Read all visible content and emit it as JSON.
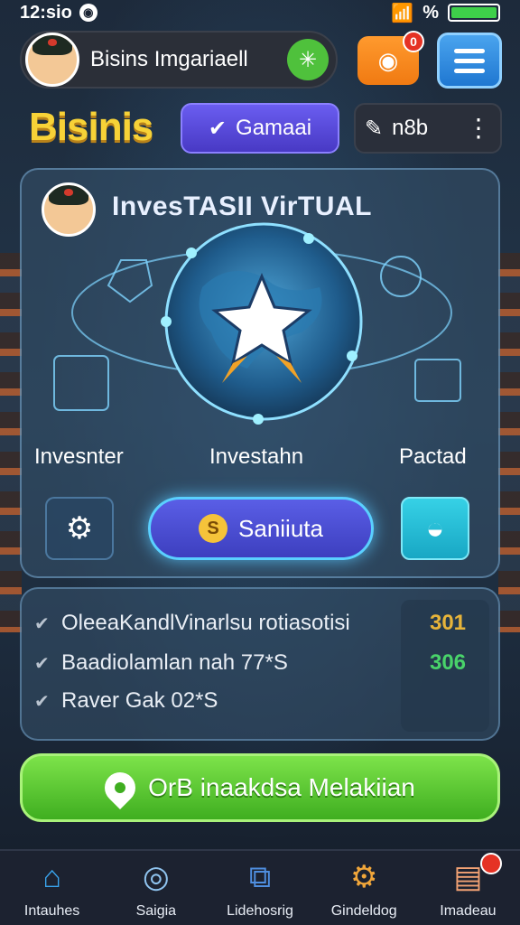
{
  "status_bar": {
    "time": "12:sio"
  },
  "header": {
    "profile_name": "Bisins Imgariaell",
    "notification_count": "0",
    "brand_title": "Bisinis",
    "mode_button_label": "Gamaai",
    "chip_label": "n8b"
  },
  "card": {
    "title": "InvesTASII VirTUAL",
    "columns": [
      "Invesnter",
      "Investahn",
      "Pactad"
    ],
    "cta_label": "Saniiuta",
    "cta_coin": "S"
  },
  "list": {
    "rows": [
      {
        "label": "OleeaKandlVinarlsu rotiasotisi",
        "value": "301",
        "value_color": "#e7b43a"
      },
      {
        "label": "Baadiolamlan nah 77*S",
        "value": "306",
        "value_color": "#49d36a"
      },
      {
        "label": "Raver Gak 02*S",
        "value": "",
        "value_color": "#ffffff"
      }
    ]
  },
  "action_button": {
    "label": "OrB inaakdsa Melakiian"
  },
  "bottom_nav": [
    {
      "label": "Intauhes",
      "icon": "home-icon"
    },
    {
      "label": "Saigia",
      "icon": "search-icon"
    },
    {
      "label": "Lidehosrig",
      "icon": "puzzle-icon"
    },
    {
      "label": "Gindeldog",
      "icon": "building-icon"
    },
    {
      "label": "Imadeau",
      "icon": "inbox-icon"
    }
  ],
  "colors": {
    "brand_yellow": "#f7d237",
    "accent_purple": "#5a5ee6",
    "accent_green": "#3fae20",
    "accent_cyan": "#36d1e6"
  }
}
